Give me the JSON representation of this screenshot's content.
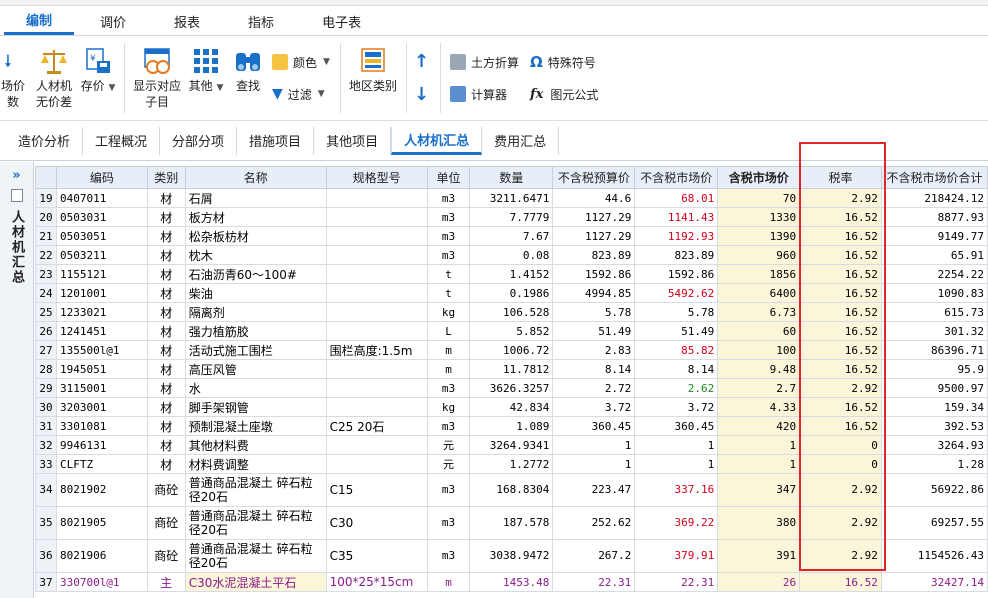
{
  "menu": {
    "tabs": [
      "编制",
      "调价",
      "报表",
      "指标",
      "电子表"
    ]
  },
  "ribbon": {
    "left_partial_1": "场价",
    "left_partial_2": "数",
    "rencaiji_label_1": "人材机",
    "rencaiji_label_2": "无价差",
    "storeprice_label": "存价",
    "showsub_label_1": "显示对应",
    "showsub_label_2": "子目",
    "other_label": "其他",
    "search_label": "查找",
    "color_label": "颜色",
    "filter_label": "过滤",
    "region_label": "地区类别",
    "earthwork_label": "土方折算",
    "special_symbol_label": "特殊符号",
    "calculator_label": "计算器",
    "formula_label": "图元公式"
  },
  "view_tabs": [
    "造价分析",
    "工程概况",
    "分部分项",
    "措施项目",
    "其他项目",
    "人材机汇总",
    "费用汇总"
  ],
  "side": {
    "arrow": "»",
    "title": "人材机汇总"
  },
  "columns": [
    "编码",
    "类别",
    "名称",
    "规格型号",
    "单位",
    "数量",
    "不含税预算价",
    "不含税市场价",
    "含税市场价",
    "税率",
    "不含税市场价合计"
  ],
  "rows": [
    {
      "no": "19",
      "code": "0407011",
      "type": "材",
      "name": "石屑",
      "spec": "",
      "unit": "m3",
      "qty": "3211.6471",
      "budget": "44.6",
      "market": "68.01",
      "tax_market": "70",
      "rate": "2.92",
      "total": "218424.12"
    },
    {
      "no": "20",
      "code": "0503031",
      "type": "材",
      "name": "板方材",
      "spec": "",
      "unit": "m3",
      "qty": "7.7779",
      "budget": "1127.29",
      "market": "1141.43",
      "tax_market": "1330",
      "rate": "16.52",
      "total": "8877.93"
    },
    {
      "no": "21",
      "code": "0503051",
      "type": "材",
      "name": "松杂板枋材",
      "spec": "",
      "unit": "m3",
      "qty": "7.67",
      "budget": "1127.29",
      "market": "1192.93",
      "tax_market": "1390",
      "rate": "16.52",
      "total": "9149.77"
    },
    {
      "no": "22",
      "code": "0503211",
      "type": "材",
      "name": "枕木",
      "spec": "",
      "unit": "m3",
      "qty": "0.08",
      "budget": "823.89",
      "market": "823.89",
      "tax_market": "960",
      "rate": "16.52",
      "total": "65.91"
    },
    {
      "no": "23",
      "code": "1155121",
      "type": "材",
      "name": "石油沥青60～100#",
      "spec": "",
      "unit": "t",
      "qty": "1.4152",
      "budget": "1592.86",
      "market": "1592.86",
      "tax_market": "1856",
      "rate": "16.52",
      "total": "2254.22"
    },
    {
      "no": "24",
      "code": "1201001",
      "type": "材",
      "name": "柴油",
      "spec": "",
      "unit": "t",
      "qty": "0.1986",
      "budget": "4994.85",
      "market": "5492.62",
      "tax_market": "6400",
      "rate": "16.52",
      "total": "1090.83"
    },
    {
      "no": "25",
      "code": "1233021",
      "type": "材",
      "name": "隔离剂",
      "spec": "",
      "unit": "kg",
      "qty": "106.528",
      "budget": "5.78",
      "market": "5.78",
      "tax_market": "6.73",
      "rate": "16.52",
      "total": "615.73"
    },
    {
      "no": "26",
      "code": "1241451",
      "type": "材",
      "name": "强力植筋胶",
      "spec": "",
      "unit": "L",
      "qty": "5.852",
      "budget": "51.49",
      "market": "51.49",
      "tax_market": "60",
      "rate": "16.52",
      "total": "301.32"
    },
    {
      "no": "27",
      "code": "135500l@1",
      "type": "材",
      "name": "活动式施工围栏",
      "spec": "围栏高度:1.5m",
      "unit": "m",
      "qty": "1006.72",
      "budget": "2.83",
      "market": "85.82",
      "tax_market": "100",
      "rate": "16.52",
      "total": "86396.71"
    },
    {
      "no": "28",
      "code": "1945051",
      "type": "材",
      "name": "高压风管",
      "spec": "",
      "unit": "m",
      "qty": "11.7812",
      "budget": "8.14",
      "market": "8.14",
      "tax_market": "9.48",
      "rate": "16.52",
      "total": "95.9"
    },
    {
      "no": "29",
      "code": "3115001",
      "type": "材",
      "name": "水",
      "spec": "",
      "unit": "m3",
      "qty": "3626.3257",
      "budget": "2.72",
      "market": "2.62",
      "tax_market": "2.7",
      "rate": "2.92",
      "total": "9500.97"
    },
    {
      "no": "30",
      "code": "3203001",
      "type": "材",
      "name": "脚手架钢管",
      "spec": "",
      "unit": "kg",
      "qty": "42.834",
      "budget": "3.72",
      "market": "3.72",
      "tax_market": "4.33",
      "rate": "16.52",
      "total": "159.34"
    },
    {
      "no": "31",
      "code": "3301081",
      "type": "材",
      "name": "预制混凝土座墩",
      "spec": "C25 20石",
      "unit": "m3",
      "qty": "1.089",
      "budget": "360.45",
      "market": "360.45",
      "tax_market": "420",
      "rate": "16.52",
      "total": "392.53"
    },
    {
      "no": "32",
      "code": "9946131",
      "type": "材",
      "name": "其他材料费",
      "spec": "",
      "unit": "元",
      "qty": "3264.9341",
      "budget": "1",
      "market": "1",
      "tax_market": "1",
      "rate": "0",
      "total": "3264.93"
    },
    {
      "no": "33",
      "code": "CLFTZ",
      "type": "材",
      "name": "材料费调整",
      "spec": "",
      "unit": "元",
      "qty": "1.2772",
      "budget": "1",
      "market": "1",
      "tax_market": "1",
      "rate": "0",
      "total": "1.28"
    },
    {
      "no": "34",
      "code": "8021902",
      "type": "商砼",
      "name": "普通商品混凝土 碎石粒径20石",
      "spec": "C15",
      "unit": "m3",
      "qty": "168.8304",
      "budget": "223.47",
      "market": "337.16",
      "tax_market": "347",
      "rate": "2.92",
      "total": "56922.86"
    },
    {
      "no": "35",
      "code": "8021905",
      "type": "商砼",
      "name": "普通商品混凝土 碎石粒径20石",
      "spec": "C30",
      "unit": "m3",
      "qty": "187.578",
      "budget": "252.62",
      "market": "369.22",
      "tax_market": "380",
      "rate": "2.92",
      "total": "69257.55"
    },
    {
      "no": "36",
      "code": "8021906",
      "type": "商砼",
      "name": "普通商品混凝土 碎石粒径20石",
      "spec": "C35",
      "unit": "m3",
      "qty": "3038.9472",
      "budget": "267.2",
      "market": "379.91",
      "tax_market": "391",
      "rate": "2.92",
      "total": "1154526.43"
    },
    {
      "no": "37",
      "code": "330700l@1",
      "type": "主",
      "name": "C30水泥混凝土平石",
      "spec": "100*25*15cm",
      "unit": "m",
      "qty": "1453.48",
      "budget": "22.31",
      "market": "22.31",
      "tax_market": "26",
      "rate": "16.52",
      "total": "32427.14"
    }
  ],
  "colors": {
    "accent": "#1a6fc9",
    "highlight_box": "#e0262b",
    "price_changed": "#d0021b",
    "price_lower": "#1e8a1e",
    "main_material": "#8b1b8b"
  }
}
